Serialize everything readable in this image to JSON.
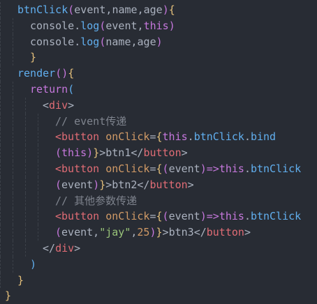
{
  "editor": {
    "lines": [
      {
        "indent": 0,
        "tokens": [
          [
            "fn",
            "btnClick"
          ],
          [
            "paren",
            "("
          ],
          [
            "id",
            "event,name,age"
          ],
          [
            "paren",
            ")"
          ],
          [
            "brace1",
            "{"
          ]
        ]
      },
      {
        "indent": 1,
        "tokens": [
          [
            "id",
            "console."
          ],
          [
            "fn",
            "log"
          ],
          [
            "paren",
            "("
          ],
          [
            "id",
            "event,"
          ],
          [
            "kw",
            "this"
          ],
          [
            "paren",
            ")"
          ]
        ]
      },
      {
        "indent": 1,
        "tokens": [
          [
            "id",
            "console."
          ],
          [
            "fn",
            "log"
          ],
          [
            "paren",
            "("
          ],
          [
            "id",
            "name,age"
          ],
          [
            "paren",
            ")"
          ]
        ]
      },
      {
        "indent": 1,
        "tokens": [
          [
            "brace1",
            "}"
          ]
        ]
      },
      {
        "indent": 0,
        "tokens": [
          [
            "fn",
            "render"
          ],
          [
            "paren",
            "()"
          ],
          [
            "brace1",
            "{"
          ]
        ]
      },
      {
        "indent": 1,
        "tokens": [
          [
            "kw",
            "return"
          ],
          [
            "paren3",
            "("
          ]
        ]
      },
      {
        "indent": 2,
        "tokens": [
          [
            "tok-punc",
            "<"
          ],
          [
            "tag",
            "div"
          ],
          [
            "tok-punc",
            ">"
          ]
        ]
      },
      {
        "indent": 3,
        "tokens": [
          [
            "comment",
            "// event传递"
          ]
        ]
      },
      {
        "indent": 3,
        "tokens": [
          [
            "tag",
            "<button"
          ],
          [
            "text",
            " "
          ],
          [
            "attr",
            "onClick"
          ],
          [
            "tok-punc",
            "="
          ],
          [
            "brace1",
            "{"
          ],
          [
            "kw",
            "this"
          ],
          [
            "id",
            "."
          ],
          [
            "fn",
            "btnClick"
          ],
          [
            "id",
            "."
          ],
          [
            "fn",
            "bind"
          ]
        ]
      },
      {
        "indent": 3,
        "tokens": [
          [
            "paren",
            "("
          ],
          [
            "kw",
            "this"
          ],
          [
            "paren",
            ")"
          ],
          [
            "brace1",
            "}"
          ],
          [
            "tok-punc",
            ">"
          ],
          [
            "text",
            "btn1"
          ],
          [
            "tok-punc",
            "</"
          ],
          [
            "tag",
            "button"
          ],
          [
            "tok-punc",
            ">"
          ]
        ]
      },
      {
        "indent": 3,
        "tokens": [
          [
            "tag",
            "<button"
          ],
          [
            "text",
            " "
          ],
          [
            "attr",
            "onClick"
          ],
          [
            "tok-punc",
            "="
          ],
          [
            "brace1",
            "{"
          ],
          [
            "paren",
            "("
          ],
          [
            "id",
            "event"
          ],
          [
            "paren",
            ")"
          ],
          [
            "kw",
            "=>"
          ],
          [
            "kw",
            "this"
          ],
          [
            "id",
            "."
          ],
          [
            "fn",
            "btnClick"
          ]
        ]
      },
      {
        "indent": 3,
        "tokens": [
          [
            "paren",
            "("
          ],
          [
            "id",
            "event"
          ],
          [
            "paren",
            ")"
          ],
          [
            "brace1",
            "}"
          ],
          [
            "tok-punc",
            ">"
          ],
          [
            "text",
            "btn2"
          ],
          [
            "tok-punc",
            "</"
          ],
          [
            "tag",
            "button"
          ],
          [
            "tok-punc",
            ">"
          ]
        ]
      },
      {
        "indent": 3,
        "tokens": [
          [
            "comment",
            "// 其他参数传递"
          ]
        ]
      },
      {
        "indent": 3,
        "tokens": [
          [
            "tag",
            "<button"
          ],
          [
            "text",
            " "
          ],
          [
            "attr",
            "onClick"
          ],
          [
            "tok-punc",
            "="
          ],
          [
            "brace1",
            "{"
          ],
          [
            "paren",
            "("
          ],
          [
            "id",
            "event"
          ],
          [
            "paren",
            ")"
          ],
          [
            "kw",
            "=>"
          ],
          [
            "kw",
            "this"
          ],
          [
            "id",
            "."
          ],
          [
            "fn",
            "btnClick"
          ]
        ]
      },
      {
        "indent": 3,
        "tokens": [
          [
            "paren",
            "("
          ],
          [
            "id",
            "event,"
          ],
          [
            "str",
            "\"jay\""
          ],
          [
            "id",
            ","
          ],
          [
            "num",
            "25"
          ],
          [
            "paren",
            ")"
          ],
          [
            "brace1",
            "}"
          ],
          [
            "tok-punc",
            ">"
          ],
          [
            "text",
            "btn3"
          ],
          [
            "tok-punc",
            "</"
          ],
          [
            "tag",
            "button"
          ],
          [
            "tok-punc",
            ">"
          ]
        ]
      },
      {
        "indent": 2,
        "tokens": [
          [
            "tok-punc",
            "</"
          ],
          [
            "tag",
            "div"
          ],
          [
            "tok-punc",
            ">"
          ]
        ]
      },
      {
        "indent": 1,
        "tokens": [
          [
            "paren3",
            ")"
          ]
        ]
      },
      {
        "indent": 0,
        "tokens": [
          [
            "brace1",
            "}"
          ]
        ]
      },
      {
        "indent": -1,
        "tokens": [
          [
            "brace1",
            "}"
          ]
        ]
      }
    ]
  },
  "colors": {
    "background": "#282c34",
    "function": "#61afef",
    "keyword": "#c678dd",
    "tag": "#e06c75",
    "attribute": "#d19a66",
    "string": "#98c379",
    "comment": "#7f848e",
    "text": "#abb2bf"
  }
}
